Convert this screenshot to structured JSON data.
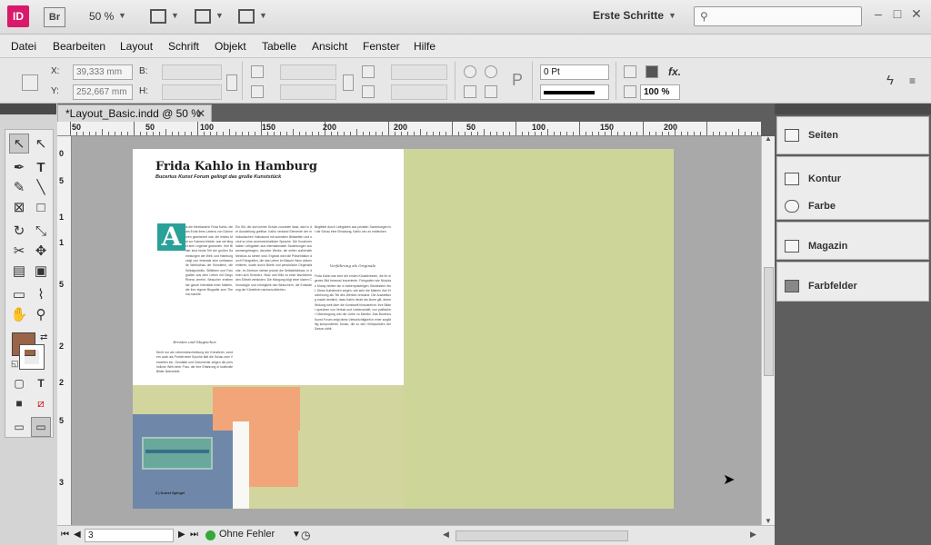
{
  "titlebar": {
    "app_icon_label": "ID",
    "bridge_label": "Br",
    "zoom": "50 %",
    "workspace": "Erste Schritte",
    "search_placeholder": "",
    "icons": [
      "view-options-icon",
      "screen-mode-icon",
      "arrange-documents-icon",
      "search-icon",
      "minimize-icon",
      "maximize-icon",
      "close-icon"
    ]
  },
  "menu": {
    "items": [
      "Datei",
      "Bearbeiten",
      "Layout",
      "Schrift",
      "Objekt",
      "Tabelle",
      "Ansicht",
      "Fenster",
      "Hilfe"
    ]
  },
  "control_panel": {
    "x_label": "X:",
    "y_label": "Y:",
    "x_value": "39,333 mm",
    "y_value": "252,667 mm",
    "w_label": "B:",
    "h_label": "H:",
    "stroke_weight": "0 Pt",
    "opacity": "100 %",
    "fx_label": "fx."
  },
  "document": {
    "tab_title": "*Layout_Basic.indd @ 50 %",
    "ruler_h": [
      "50",
      "0",
      "50",
      "100",
      "150",
      "200",
      "50",
      "100",
      "150",
      "200"
    ],
    "ruler_v": [
      "0",
      "5",
      "1",
      "1",
      "5",
      "2",
      "2",
      "5",
      "3"
    ],
    "status": {
      "page": "3",
      "preflight": "Ohne Fehler"
    }
  },
  "article": {
    "title": "Frida Kahlo in Hamburg",
    "subtitle": "Bucerius Kunst Forum gelingt das große Kunststück",
    "dropcap": "A",
    "col1_head": "Ernstes und Magisches",
    "col3_head": "Verführung als Originale",
    "col1_text": "ls die Mexikanerin Frida Kahlo, die am Ende ihres Lebens von Schmerzen gezeichnet war, ein letztes Mal zur Kamera blickte, war sie längst eine Legende geworden. Ihre Bilder sind heute Teil der großen Sammlungen der Welt, und Hamburg zeigt nun erstmals eine umfassende Werkschau der Künstlerin, die Selbstporträts, Stillleben und Fotografien aus dem Leben mit Diego Rivera vereint. Besucher erleben die ganze Intensität einer Malerin, die ihre eigene Biografie zum Thema machte.",
    "col1_text_b": "Nicht nur als Lebensbeschreibung der Künstlerin, sondern auch als Porträt einer Epoche lädt die Schau zum Verweilen ein. Gemälde und Dokumente zeigen die persönliche Welt einer Frau, die ihre Erfahrung in kraftvolle Bilder übersetzte.",
    "col2_text": "Ein Stil, der sich keiner Schule zuordnen lässt, wird in der Ausstellung greifbar. Kahlo verband Elemente der mexikanischen Volkskunst mit surrealen Bildwelten und schuf so eine unverwechselbare Sprache. Die Kuratoren haben Leihgaben aus internationalen Sammlungen zusammengetragen, darunter Werke, die selten außerhalb Mexikos zu sehen sind. Ergänzt wird die Präsentation durch Fotografien, die das Leben im Blauen Haus dokumentieren, sowie durch Briefe und persönliche Gegenstände. Im Zentrum stehen jedoch die Selbstbildnisse, in denen sich Schmerz, Stolz und Witz zu einer faszinierenden Einheit verbinden. Die Hängung folgt einer klaren Chronologie und ermöglicht den Besuchern, die Entwicklung der Künstlerin nachzuvollziehen.",
    "col3_text": "Frida Kahlo war eine der ersten Künstlerinnen, die ihr eigenes Bild bewusst inszenierte. Fotografen wie Nickolas Muray hielten sie in farbenprächtigen Gewändern fest. Diese Aufnahmen zeigen, wie sehr die Malerin ihre Erscheinung als Teil des Werkes verstand. Die Ausstellung macht deutlich, dass Kahlo heute als Ikone gilt, deren Wirkung weit über die Kunstwelt hinausreicht. Ihre Bilder sprechen von Verlust und Leidenschaft, von politischer Überzeugung und der Liebe zu Mexiko. Das Bucerius Kunst Forum zeigt diese Vielschichtigkeit in einer sorgfältig komponierten Schau, die zu den Höhepunkten der Saison zählt.",
    "col3_text_b": "Begleitet durch Leihgaben aus privaten Sammlungen ist die Schau eine Einladung, Kahlo neu zu entdecken.",
    "folio": "2  |  Kunst Spiegel"
  },
  "right_panel": {
    "items": [
      "Seiten",
      "Kontur",
      "Farbe",
      "Magazin",
      "Farbfelder"
    ]
  },
  "colors": {
    "accent_teal": "#2aa198",
    "fill_swatch": "#9b6347",
    "page_green": "#cdd698",
    "image_orange": "#f2a579",
    "image_blue": "#6f87a9"
  }
}
